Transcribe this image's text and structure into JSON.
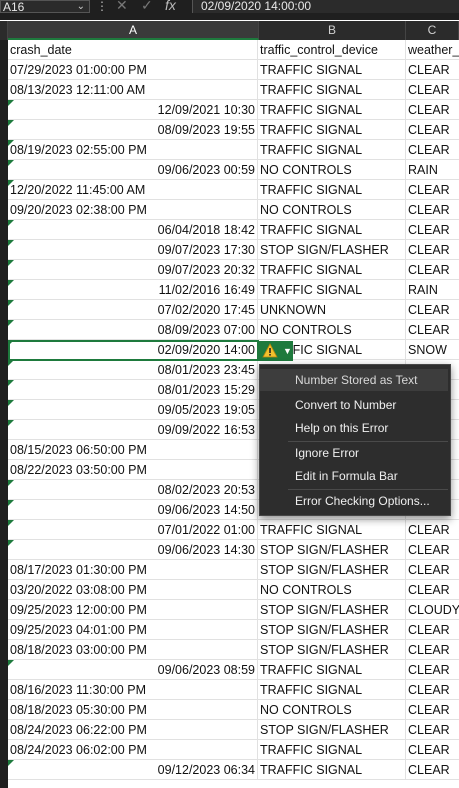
{
  "formula_bar": {
    "name_box": "A16",
    "formula": "02/09/2020  14:00:00",
    "fx": "fx",
    "cancel": "✕",
    "confirm": "✓"
  },
  "columns": [
    {
      "letter": "A",
      "header": "crash_date"
    },
    {
      "letter": "B",
      "header": "traffic_control_device"
    },
    {
      "letter": "C",
      "header": "weather_"
    }
  ],
  "rows": [
    {
      "a": "07/29/2023 01:00:00 PM",
      "b": "TRAFFIC SIGNAL",
      "c": "CLEAR",
      "a_right": false,
      "flag": false
    },
    {
      "a": "08/13/2023 12:11:00 AM",
      "b": "TRAFFIC SIGNAL",
      "c": "CLEAR",
      "a_right": false,
      "flag": false
    },
    {
      "a": "12/09/2021 10:30",
      "b": "TRAFFIC SIGNAL",
      "c": "CLEAR",
      "a_right": true,
      "flag": true
    },
    {
      "a": "08/09/2023 19:55",
      "b": "TRAFFIC SIGNAL",
      "c": "CLEAR",
      "a_right": true,
      "flag": true
    },
    {
      "a": "08/19/2023 02:55:00 PM",
      "b": "TRAFFIC SIGNAL",
      "c": "CLEAR",
      "a_right": false,
      "flag": true
    },
    {
      "a": "09/06/2023 00:59",
      "b": "NO CONTROLS",
      "c": "RAIN",
      "a_right": true,
      "flag": true
    },
    {
      "a": "12/20/2022 11:45:00 AM",
      "b": "TRAFFIC SIGNAL",
      "c": "CLEAR",
      "a_right": false,
      "flag": true
    },
    {
      "a": "09/20/2023 02:38:00 PM",
      "b": "NO CONTROLS",
      "c": "CLEAR",
      "a_right": false,
      "flag": false
    },
    {
      "a": "06/04/2018 18:42",
      "b": "TRAFFIC SIGNAL",
      "c": "CLEAR",
      "a_right": true,
      "flag": true
    },
    {
      "a": "09/07/2023 17:30",
      "b": "STOP SIGN/FLASHER",
      "c": "CLEAR",
      "a_right": true,
      "flag": true
    },
    {
      "a": "09/07/2023 20:32",
      "b": "TRAFFIC SIGNAL",
      "c": "CLEAR",
      "a_right": true,
      "flag": true
    },
    {
      "a": "11/02/2016 16:49",
      "b": "TRAFFIC SIGNAL",
      "c": "RAIN",
      "a_right": true,
      "flag": true
    },
    {
      "a": "07/02/2020 17:45",
      "b": "UNKNOWN",
      "c": "CLEAR",
      "a_right": true,
      "flag": true
    },
    {
      "a": "08/09/2023 07:00",
      "b": "NO CONTROLS",
      "c": "CLEAR",
      "a_right": true,
      "flag": true
    },
    {
      "a": "02/09/2020 14:00",
      "b": "TRAFFIC SIGNAL",
      "c": "SNOW",
      "a_right": true,
      "flag": true
    },
    {
      "a": "08/01/2023 23:45",
      "b": "",
      "c": "",
      "a_right": true,
      "flag": true
    },
    {
      "a": "08/01/2023 15:29",
      "b": "",
      "c": "",
      "a_right": true,
      "flag": true
    },
    {
      "a": "09/05/2023 19:05",
      "b": "",
      "c": "",
      "a_right": true,
      "flag": true
    },
    {
      "a": "09/09/2022 16:53",
      "b": "",
      "c": "",
      "a_right": true,
      "flag": true
    },
    {
      "a": "08/15/2023 06:50:00 PM",
      "b": "",
      "c": "",
      "a_right": false,
      "flag": false
    },
    {
      "a": "08/22/2023 03:50:00 PM",
      "b": "",
      "c": "",
      "a_right": false,
      "flag": false
    },
    {
      "a": "08/02/2023 20:53",
      "b": "",
      "c": "",
      "a_right": true,
      "flag": true
    },
    {
      "a": "09/06/2023 14:50",
      "b": "STOP SIGN/FLASHER",
      "c": "CLEAR",
      "a_right": true,
      "flag": true
    },
    {
      "a": "07/01/2022 01:00",
      "b": "TRAFFIC SIGNAL",
      "c": "CLEAR",
      "a_right": true,
      "flag": true
    },
    {
      "a": "09/06/2023 14:30",
      "b": "STOP SIGN/FLASHER",
      "c": "CLEAR",
      "a_right": true,
      "flag": true
    },
    {
      "a": "08/17/2023 01:30:00 PM",
      "b": "STOP SIGN/FLASHER",
      "c": "CLEAR",
      "a_right": false,
      "flag": false
    },
    {
      "a": "03/20/2022 03:08:00 PM",
      "b": "NO CONTROLS",
      "c": "CLEAR",
      "a_right": false,
      "flag": false
    },
    {
      "a": "09/25/2023 12:00:00 PM",
      "b": "STOP SIGN/FLASHER",
      "c": "CLOUDY/",
      "a_right": false,
      "flag": false
    },
    {
      "a": "09/25/2023 04:01:00 PM",
      "b": "STOP SIGN/FLASHER",
      "c": "CLEAR",
      "a_right": false,
      "flag": false
    },
    {
      "a": "08/18/2023 03:00:00 PM",
      "b": "STOP SIGN/FLASHER",
      "c": "CLEAR",
      "a_right": false,
      "flag": false
    },
    {
      "a": "09/06/2023 08:59",
      "b": "TRAFFIC SIGNAL",
      "c": "CLEAR",
      "a_right": true,
      "flag": true
    },
    {
      "a": "08/16/2023 11:30:00 PM",
      "b": "TRAFFIC SIGNAL",
      "c": "CLEAR",
      "a_right": false,
      "flag": false
    },
    {
      "a": "08/18/2023 05:30:00 PM",
      "b": "NO CONTROLS",
      "c": "CLEAR",
      "a_right": false,
      "flag": false
    },
    {
      "a": "08/24/2023 06:22:00 PM",
      "b": "STOP SIGN/FLASHER",
      "c": "CLEAR",
      "a_right": false,
      "flag": false
    },
    {
      "a": "08/24/2023 06:02:00 PM",
      "b": "TRAFFIC SIGNAL",
      "c": "CLEAR",
      "a_right": false,
      "flag": false
    },
    {
      "a": "09/12/2023 06:34",
      "b": "TRAFFIC SIGNAL",
      "c": "CLEAR",
      "a_right": true,
      "flag": true
    }
  ],
  "error_menu": {
    "icon": "warning-icon",
    "items": [
      "Number Stored as Text",
      "Convert to Number",
      "Help on this Error",
      "Ignore Error",
      "Edit in Formula Bar",
      "Error Checking Options..."
    ]
  },
  "colors": {
    "accent": "#1e7a3d",
    "warning": "#f2c12e",
    "menu_bg": "#2d2d2d",
    "header_bg": "#2b2b2b"
  }
}
